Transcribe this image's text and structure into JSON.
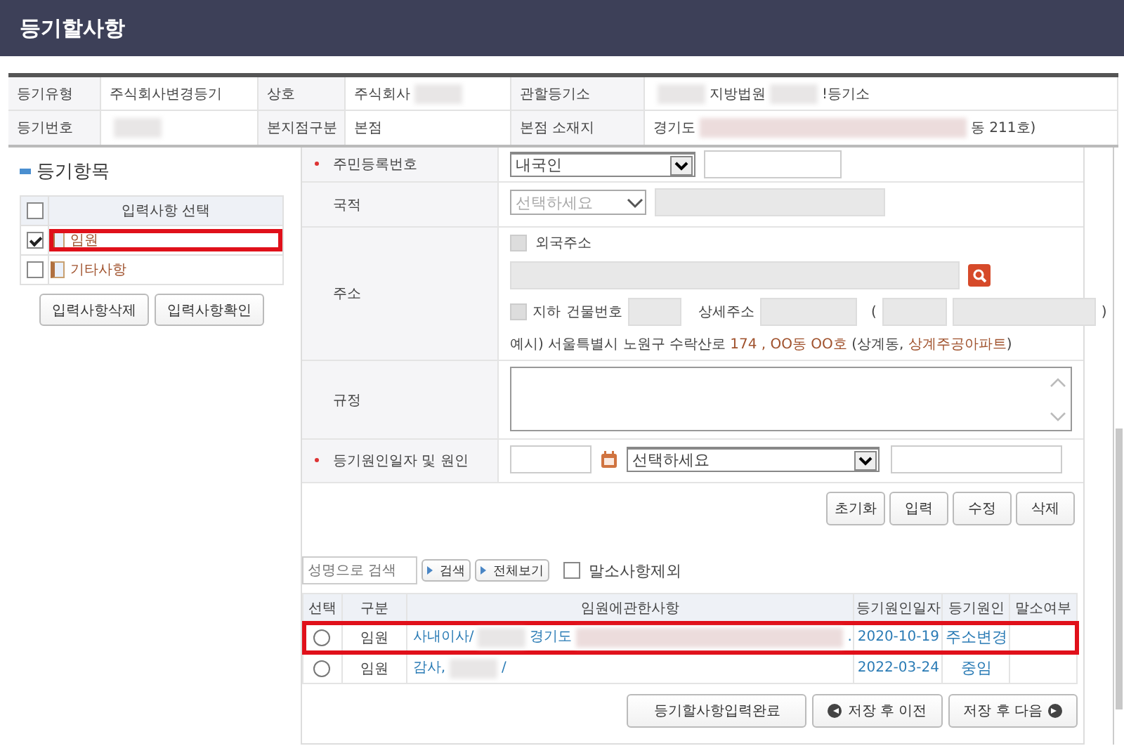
{
  "title": "등기할사항",
  "info": [
    [
      {
        "label": "등기유형",
        "parts": [
          {
            "text": "주식회사변경등기"
          }
        ]
      },
      {
        "label": "상호",
        "parts": [
          {
            "text": "주식회사"
          },
          {
            "kind": "blur"
          }
        ]
      },
      {
        "label": "관할등기소",
        "parts": [
          {
            "kind": "blur"
          },
          {
            "text": "지방법원"
          },
          {
            "kind": "blur"
          },
          {
            "text": "!등기소"
          }
        ]
      }
    ],
    [
      {
        "label": "등기번호",
        "parts": [
          {
            "kind": "blur"
          }
        ]
      },
      {
        "label": "본지점구분",
        "parts": [
          {
            "text": "본점"
          }
        ]
      },
      {
        "label": "본점 소재지",
        "parts": [
          {
            "text": "경기도"
          },
          {
            "kind": "blur",
            "wide": true
          },
          {
            "text": "동 211호)"
          }
        ]
      }
    ]
  ],
  "items": {
    "heading": "등기항목",
    "header": "입력사항 선택",
    "header_checked": false,
    "rows": [
      {
        "label": "임원",
        "checked": true,
        "highlighted": true
      },
      {
        "label": "기타사항",
        "checked": false,
        "highlighted": false
      }
    ],
    "buttons": [
      "입력사항삭제",
      "입력사항확인"
    ]
  },
  "form": [
    {
      "kind": "resident",
      "label": "주민등록번호",
      "required": true,
      "select": "내국인"
    },
    {
      "kind": "nationality",
      "label": "국적",
      "required": false,
      "placeholder": "선택하세요"
    },
    {
      "kind": "address",
      "label": "주소",
      "required": false,
      "foreign_label": "외국주소",
      "foreign_checked": false,
      "basement_label": "지하",
      "basement_checked": false,
      "building_label": "건물번호",
      "detail_label": "상세주소",
      "open_paren": "(",
      "close_paren": ")",
      "example": [
        {
          "text": "예시) 서울특별시 노원구 수락산로 ",
          "accent": false
        },
        {
          "text": "174 , OO동 OO호",
          "accent": true
        },
        {
          "text": " (상계동, ",
          "accent": false
        },
        {
          "text": "상계주공아파트",
          "accent": true
        },
        {
          "text": ")",
          "accent": false
        }
      ]
    },
    {
      "kind": "textarea",
      "label": "규정",
      "required": false
    },
    {
      "kind": "cause",
      "label": "등기원인일자 및 원인",
      "required": true,
      "select": "선택하세요"
    }
  ],
  "actions": [
    "초기화",
    "입력",
    "수정",
    "삭제"
  ],
  "search": {
    "placeholder": "성명으로 검색",
    "buttons": [
      "검색",
      "전체보기"
    ],
    "exclude_label": "말소사항제외",
    "exclude_checked": false
  },
  "grid": {
    "columns": [
      "선택",
      "구분",
      "임원에관한사항",
      "등기원인일자",
      "등기원인",
      "말소여부"
    ],
    "rows": [
      {
        "selected": false,
        "highlighted": true,
        "type": "임원",
        "detail": [
          {
            "text": "사내이사/"
          },
          {
            "kind": "blur"
          },
          {
            "text": "경기도"
          },
          {
            "kind": "blur",
            "wide": true
          },
          {
            "text": "."
          }
        ],
        "date": "2020-10-19",
        "cause": "주소변경"
      },
      {
        "selected": false,
        "highlighted": false,
        "type": "임원",
        "detail": [
          {
            "text": "감사,"
          },
          {
            "kind": "blur"
          },
          {
            "text": "/"
          }
        ],
        "date": "2022-03-24",
        "cause": "중임"
      }
    ]
  },
  "footer": [
    {
      "label": "등기할사항입력완료",
      "kind": "plain"
    },
    {
      "label": "저장 후 이전",
      "kind": "prev"
    },
    {
      "label": "저장 후 다음",
      "kind": "next"
    }
  ]
}
